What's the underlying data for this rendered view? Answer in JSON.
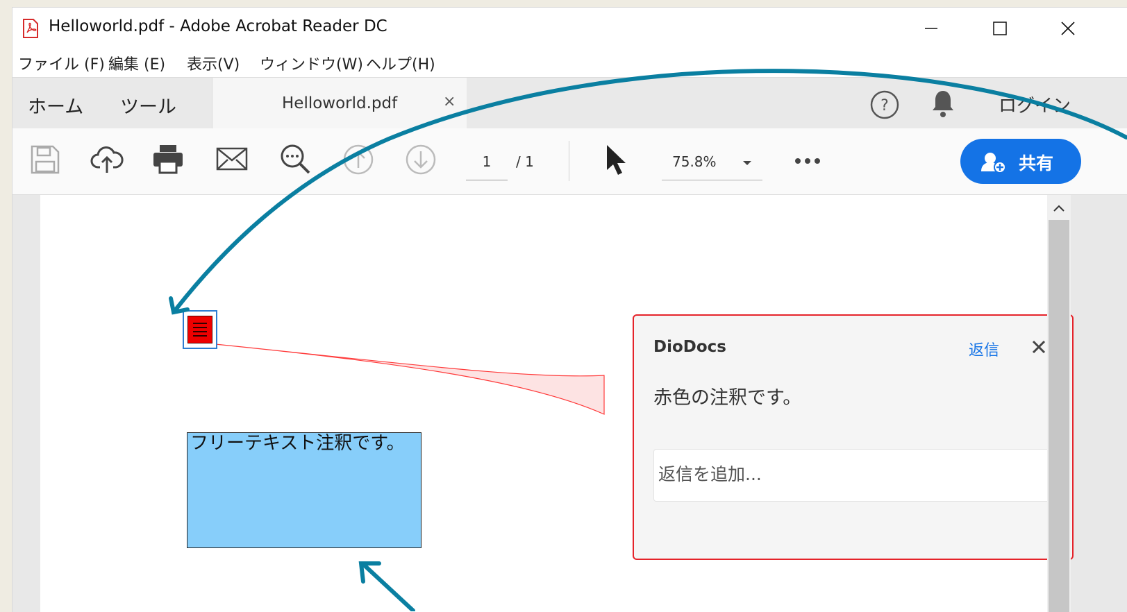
{
  "window": {
    "title": "Helloworld.pdf - Adobe Acrobat Reader DC"
  },
  "menu": [
    "ファイル (F)",
    "編集 (E)",
    "表示(V)",
    "ウィンドウ(W)",
    "ヘルプ(H)"
  ],
  "tabs": {
    "home": "ホーム",
    "tools": "ツール",
    "document": "Helloworld.pdf",
    "close": "×",
    "login": "ログイン"
  },
  "toolbar": {
    "page_current": "1",
    "page_total": "/ 1",
    "zoom": "75.8%",
    "share_label": "共有",
    "icons": [
      "save-icon",
      "cloud-upload-icon",
      "print-icon",
      "mail-icon",
      "zoom-out-icon",
      "page-up-icon",
      "page-down-icon",
      "select-cursor-icon",
      "more-icon"
    ]
  },
  "annotations": {
    "free_text": "フリーテキスト注釈です。",
    "note_color": "#ee0000",
    "free_text_bg": "#87cefa"
  },
  "popup": {
    "author": "DioDocs",
    "reply_link": "返信",
    "content": "赤色の注釈です。",
    "reply_placeholder": "返信を追加..."
  },
  "colors": {
    "accent": "#1473e6",
    "popup_border": "#e5232a",
    "callout_arrow": "#0a7fa1"
  }
}
